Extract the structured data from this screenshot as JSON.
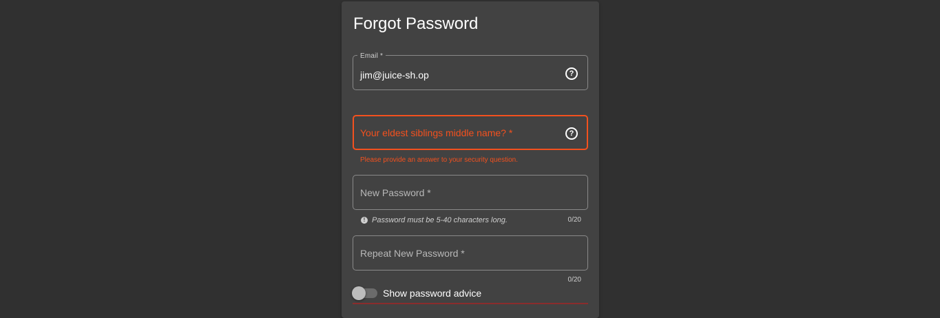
{
  "form": {
    "title": "Forgot Password",
    "email": {
      "label": "Email *",
      "value": "jim@juice-sh.op",
      "help_icon": "help-circle-icon"
    },
    "security_answer": {
      "placeholder": "Your eldest siblings middle name? *",
      "error": "Please provide an answer to your security question.",
      "help_icon": "help-circle-icon"
    },
    "new_password": {
      "placeholder": "New Password *",
      "hint": "Password must be 5-40 characters long.",
      "hint_icon": "info-icon",
      "counter": "0/20"
    },
    "repeat_password": {
      "placeholder": "Repeat New Password *",
      "counter": "0/20"
    },
    "advice_toggle": {
      "label": "Show password advice",
      "checked": false
    }
  },
  "colors": {
    "background": "#303030",
    "card": "#424242",
    "error": "#f4511e",
    "strength_bar": "#8b2c2c"
  }
}
